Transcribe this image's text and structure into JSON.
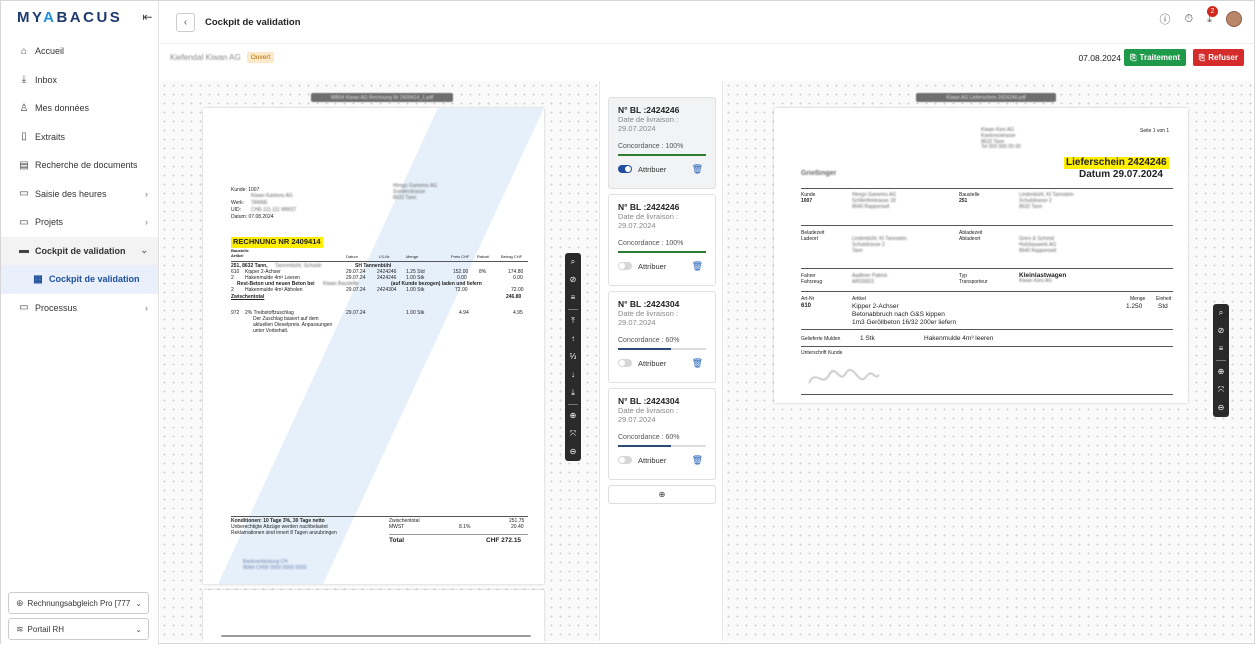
{
  "brand": {
    "logo_a": "MY",
    "logo_b": "A",
    "logo_c": "BACUS"
  },
  "sidebar": {
    "items": [
      {
        "label": "Accueil",
        "icon": "home-icon"
      },
      {
        "label": "Inbox",
        "icon": "inbox-icon"
      },
      {
        "label": "Mes données",
        "icon": "user-icon"
      },
      {
        "label": "Extraits",
        "icon": "file-icon"
      },
      {
        "label": "Recherche de documents",
        "icon": "search-doc-icon"
      },
      {
        "label": "Saisie des heures",
        "icon": "folder-icon"
      },
      {
        "label": "Projets",
        "icon": "folder-icon"
      },
      {
        "label": "Cockpit de validation",
        "icon": "folder-open-icon"
      },
      {
        "label": "Cockpit de validation",
        "icon": "stack-icon"
      },
      {
        "label": "Processus",
        "icon": "folder-icon"
      }
    ],
    "company_select": "Rechnungsabgleich Pro [777",
    "portal_select": "Portail RH"
  },
  "topbar": {
    "title": "Cockpit de validation",
    "notif_count": "2"
  },
  "subheader": {
    "supplier": "Kiefendal Kiwan AG",
    "status": "Ouvert",
    "date": "07.08.2024",
    "btn_accept": "Traitement",
    "btn_reject": "Refuser"
  },
  "invoice": {
    "filename": "WB04 Kiwan AG Rechnung Nr 2409414_1.pdf",
    "kunde": "Kunde:  1007",
    "werk": "Werk:",
    "uid": "UID:",
    "datum": "Datum:  07.08.2024",
    "title": "RECHNUNG NR 2409414",
    "baustelle": "Baustelle",
    "head": [
      "Artikel",
      "Datum",
      "LS-Nr.",
      "Menge",
      "Preis CHF",
      "Rabatt",
      "Betrag CHF"
    ],
    "site": "251, 8632 Tann,",
    "site2": "SH Tannenbühl",
    "r1": [
      "610",
      "Kipper 2-Achser",
      "29.07.24",
      "2424246",
      "1.25 Std",
      "152.00",
      "8%",
      "174.80"
    ],
    "r2": [
      "2",
      "Hakenmulde 4m³ Leeren",
      "29.07.24",
      "2424246",
      "1.00 Stk",
      "0.00",
      "",
      "0.00"
    ],
    "rest": "Rest-Beton und neuen Beton bei",
    "rest2": "(auf Kunde bezogen) laden und liefern",
    "r3": [
      "2",
      "Hakenmulde 4m³ Abholen",
      "29.07.24",
      "2424304",
      "1.00 Stk",
      "72.00",
      "",
      "72.00"
    ],
    "zwischen": "Zwischentotal",
    "zwischen_val": "246.80",
    "r4": [
      "972",
      "2% Treibstoffzuschlag",
      "29.07.24",
      "",
      "1.00 Stk",
      "4.94",
      "",
      "4.95"
    ],
    "r4_note": [
      "Der Zuschlag basiert auf dem",
      "aktuellen Dieselpreis. Anpassungen",
      "unter Vorbehalt."
    ],
    "cond": [
      "Konditionen: 10 Tage 3%, 30 Tage netto",
      "Unberechtigte Abzüge werden nachbelastet",
      "Reklamationen sind innert 8 Tagen anzubringen"
    ],
    "tot_labels": [
      "Zwischentotal",
      "MWST",
      "Total"
    ],
    "mwst_rate": "8.1%",
    "tot_vals": [
      "251.75",
      "20.40",
      "CHF 272.15"
    ]
  },
  "cards": [
    {
      "no": "N° BL :2424246",
      "dl": "Date de livraison :",
      "date": "29.07.2024",
      "conc": "Concordance : 100%",
      "pct": 100,
      "color": "#2e7d32",
      "attr": "Attribuer",
      "on": true
    },
    {
      "no": "N° BL :2424246",
      "dl": "Date de livraison :",
      "date": "29.07.2024",
      "conc": "Concordance : 100%",
      "pct": 100,
      "color": "#2e7d32",
      "attr": "Attribuer",
      "on": false
    },
    {
      "no": "N° BL :2424304",
      "dl": "Date de livraison :",
      "date": "29.07.2024",
      "conc": "Concordance : 60%",
      "pct": 60,
      "color": "#2a4a78",
      "attr": "Attribuer",
      "on": false
    },
    {
      "no": "N° BL :2424304",
      "dl": "Date de livraison :",
      "date": "29.07.2024",
      "conc": "Concordance : 60%",
      "pct": 60,
      "color": "#2a4a78",
      "attr": "Attribuer",
      "on": false
    }
  ],
  "delivery": {
    "filename": "Kiwan AG Lieferschein 2424246.pdf",
    "seite": "Seite 1 von 1",
    "title": "Lieferschein 2424246",
    "datum": "Datum 29.07.2024",
    "kunde_l": "Kunde",
    "kunde_v": "1007",
    "baust_l": "Baustelle",
    "baust_v": "251",
    "belade_l": "Beladezeit",
    "ladeort_l": "Ladeort",
    "ablade_l": "Abladezeit",
    "abladeort_l": "Abladeort",
    "fahrer_l": "Fahrer",
    "fahrzeug_l": "Fahrzeug",
    "typ_l": "Typ",
    "transp_l": "Transporteur",
    "typ_v": "Kleinlastwagen",
    "artnr_l": "Art-Nr",
    "artnr_v": "610",
    "artikel_l": "Artikel",
    "artikel_v": "Kipper 2-Achser",
    "art2": "Betonabbruch nach G&S kippen",
    "art3": "1m3 Geröllbeton 16/32 200er liefern",
    "menge_l": "Menge",
    "menge_v": "1.250",
    "einheit_l": "Einheit",
    "einheit_v": "Std",
    "mulden_l": "Gelieferte Mulden",
    "mulden_q": "1 Stk",
    "mulden_v": "Hakenmulde 4m³ leeren",
    "sign_l": "Unterschrift Kunde"
  }
}
